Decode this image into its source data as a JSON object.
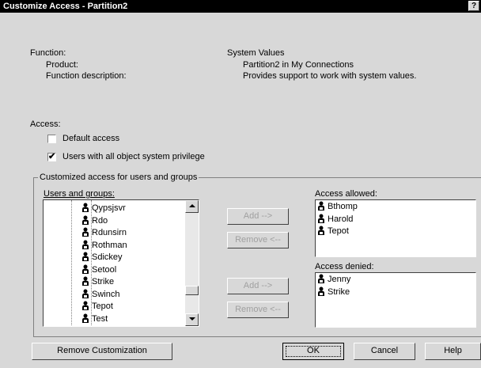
{
  "window": {
    "title": "Customize Access - Partition2",
    "help_button": "?"
  },
  "function_info": {
    "function_label": "Function:",
    "product_label": "Product:",
    "description_label": "Function description:",
    "function_value": "System Values",
    "product_value": "Partition2 in My Connections",
    "description_value": "Provides support to work with system values."
  },
  "access": {
    "label": "Access:",
    "default_access": {
      "label": "Default access",
      "checked": false
    },
    "all_object_privilege": {
      "label": "Users with all object system privilege",
      "checked": true
    }
  },
  "customized": {
    "group_label": "Customized access for users and groups",
    "users_label": "Users and groups:",
    "users": [
      "Qypsjsvr",
      "Rdo",
      "Rdunsirn",
      "Rothman",
      "Sdickey",
      "Setool",
      "Strike",
      "Swinch",
      "Tepot",
      "Test"
    ],
    "add_allowed_button": "Add -->",
    "remove_allowed_button": "Remove <--",
    "add_denied_button": "Add -->",
    "remove_denied_button": "Remove <--",
    "allowed_label": "Access allowed:",
    "allowed": [
      "Bthomp",
      "Harold",
      "Tepot"
    ],
    "denied_label": "Access denied:",
    "denied": [
      "Jenny",
      "Strike"
    ]
  },
  "buttons": {
    "remove_customization": "Remove Customization",
    "ok": "OK",
    "cancel": "Cancel",
    "help": "Help"
  },
  "icons": {
    "user": "user-lock-icon",
    "scroll_up": "arrow-up-icon",
    "scroll_down": "arrow-down-icon"
  }
}
